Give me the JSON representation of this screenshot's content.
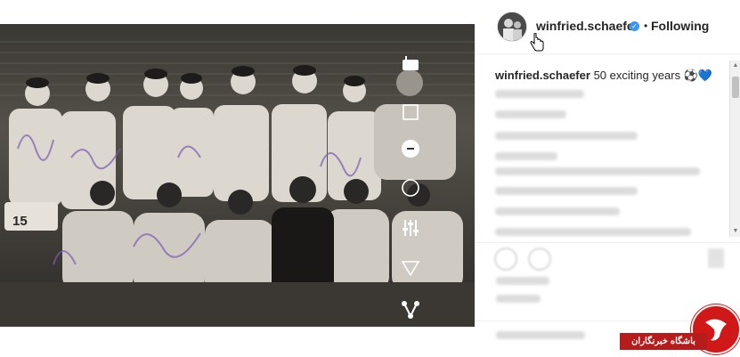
{
  "post": {
    "username": "winfried.schaefer",
    "follow_status": "Following",
    "separator": "•",
    "caption_user": "winfried.schaefer",
    "caption_text": "50 exciting years ⚽💙",
    "jersey_number": "15"
  },
  "icons": {
    "verified": "verified-badge-icon",
    "cursor": "hand-pointer-icon",
    "tools": [
      "stamp-icon",
      "square-icon",
      "sticker-icon",
      "circle-icon",
      "sliders-icon",
      "triangle-icon",
      "share-nodes-icon"
    ]
  },
  "watermark": {
    "text": "باشگاه خبرنگاران"
  },
  "colors": {
    "accent": "#3897f0",
    "text": "#262626",
    "watermark_red": "#d01818"
  }
}
